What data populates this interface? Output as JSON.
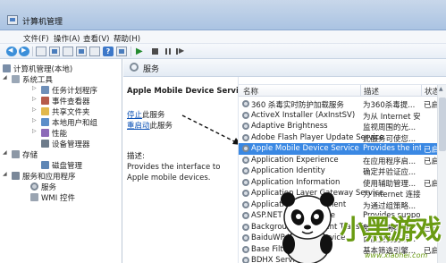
{
  "window": {
    "title": "计算机管理"
  },
  "menu": [
    "文件(F)",
    "操作(A)",
    "查看(V)",
    "帮助(H)"
  ],
  "toolbar": {
    "icons": [
      "back-icon",
      "forward-icon",
      "up-folder-icon",
      "show-tree-icon",
      "properties-icon",
      "refresh-icon",
      "export-icon",
      "help-icon",
      "start-service-icon",
      "stop-service-icon",
      "pause-service-icon",
      "restart-service-icon"
    ]
  },
  "tree": {
    "root": "计算机管理(本地)",
    "system_tools": "系统工具",
    "task_scheduler": "任务计划程序",
    "event_viewer": "事件查看器",
    "shared_folders": "共享文件夹",
    "local_users": "本地用户和组",
    "performance": "性能",
    "device_manager": "设备管理器",
    "storage": "存储",
    "disk_management": "磁盘管理",
    "services_apps": "服务和应用程序",
    "services": "服务",
    "wmi": "WMI 控件"
  },
  "services_header": {
    "title": "服务"
  },
  "detail": {
    "service_name": "Apple Mobile Device Service",
    "stop_link": "停止",
    "stop_suffix": "此服务",
    "restart_link": "重启动",
    "restart_suffix": "此服务",
    "desc_label": "描述:",
    "desc_text": "Provides the interface to Apple mobile devices."
  },
  "list": {
    "columns": {
      "name": "名称",
      "description": "描述",
      "status": "状态"
    },
    "rows": [
      {
        "name": "360 杀毒实时防护加载服务",
        "description": "为360杀毒提...",
        "status": "已启"
      },
      {
        "name": "ActiveX Installer (AxInstSV)",
        "description": "为从 Internet 安...",
        "status": ""
      },
      {
        "name": "Adaptive Brightness",
        "description": "监视周围的光...",
        "status": ""
      },
      {
        "name": "Adobe Flash Player Update Service",
        "description": "此服务可使您...",
        "status": ""
      },
      {
        "name": "Apple Mobile Device Service",
        "description": "Provides the int...",
        "status": "已启",
        "selected": true
      },
      {
        "name": "Application Experience",
        "description": "在应用程序启...",
        "status": "已启"
      },
      {
        "name": "Application Identity",
        "description": "确定并验证应...",
        "status": ""
      },
      {
        "name": "Application Information",
        "description": "使用辅助管理...",
        "status": "已启"
      },
      {
        "name": "Application Layer Gateway Service",
        "description": "为 Internet 连接...",
        "status": ""
      },
      {
        "name": "Application Management",
        "description": "为通过组策略...",
        "status": ""
      },
      {
        "name": "ASP.NET State Service",
        "description": "Provides suppo...",
        "status": ""
      },
      {
        "name": "Background Intelligent Transfer Service",
        "description": "使用空闲网络...",
        "status": "已启"
      },
      {
        "name": "BaiduWP Update Service",
        "description": "百度卫士更新...",
        "status": ""
      },
      {
        "name": "Base Filtering Engine",
        "description": "基本筛选引擎...",
        "status": "已启"
      },
      {
        "name": "BDHX Service",
        "description": "",
        "status": ""
      }
    ]
  },
  "watermark": {
    "text": "小黑游戏",
    "url": "www.xiaohei.com"
  },
  "colors": {
    "selection": "#3a88e3",
    "link": "#0a50b5",
    "watermark": "#6a9b12"
  }
}
